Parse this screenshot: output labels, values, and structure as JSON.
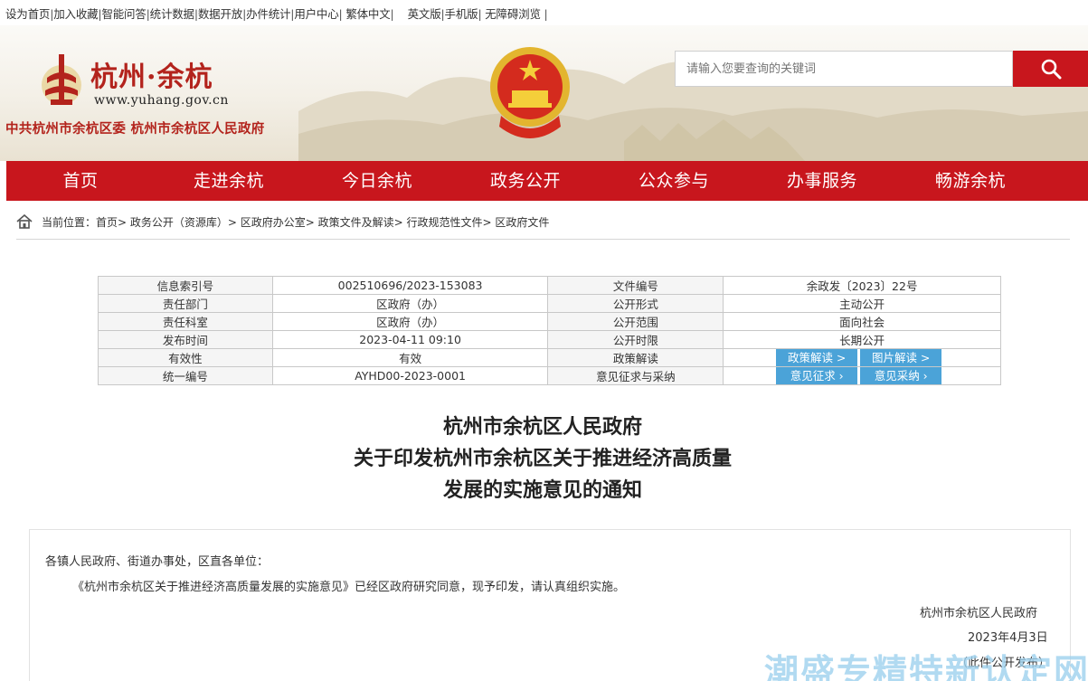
{
  "toplinks": [
    "设为首页",
    "加入收藏",
    "智能问答",
    "统计数据",
    "数据开放",
    "办件统计",
    "用户中心",
    "繁体中文",
    "英文版",
    "手机版",
    "无障碍浏览"
  ],
  "header": {
    "logo_title": "杭州·余杭",
    "logo_url": "www.yuhang.gov.cn",
    "gov_name": "中共杭州市余杭区委  杭州市余杭区人民政府",
    "search_placeholder": "请输入您要查询的关键词"
  },
  "nav": [
    "首页",
    "走进余杭",
    "今日余杭",
    "政务公开",
    "公众参与",
    "办事服务",
    "畅游余杭"
  ],
  "breadcrumb": "当前位置：首页> 政务公开（资源库）> 区政府办公室> 政策文件及解读> 行政规范性文件> 区政府文件",
  "info": {
    "row1": [
      "信息索引号",
      "002510696/2023-153083",
      "文件编号",
      "余政发〔2023〕22号"
    ],
    "row2": [
      "责任部门",
      "区政府（办）",
      "公开形式",
      "主动公开"
    ],
    "row3": [
      "责任科室",
      "区政府（办）",
      "公开范围",
      "面向社会"
    ],
    "row4": [
      "发布时间",
      "2023-04-11 09:10",
      "公开时限",
      "长期公开"
    ],
    "row5": [
      "有效性",
      "有效",
      "政策解读"
    ],
    "row6": [
      "统一编号",
      "AYHD00-2023-0001",
      "意见征求与采纳"
    ],
    "btn_policy": "政策解读 >",
    "btn_picture": "图片解读 >",
    "btn_opinion": "意见征求  ›",
    "btn_adopt": "意见采纳  ›"
  },
  "doc": {
    "title_line1": "杭州市余杭区人民政府",
    "title_line2": "关于印发杭州市余杭区关于推进经济高质量",
    "title_line3": "发展的实施意见的通知",
    "salutation": "各镇人民政府、街道办事处，区直各单位：",
    "body": "《杭州市余杭区关于推进经济高质量发展的实施意见》已经区政府研究同意，现予印发，请认真组织实施。",
    "signature": "杭州市余杭区人民政府",
    "date": "2023年4月3日",
    "note": "（此件公开发布）"
  },
  "watermark": "潮盛专精特新认定网",
  "colors": {
    "brand_red": "#c8161d",
    "button_blue": "#4ba3d8"
  }
}
